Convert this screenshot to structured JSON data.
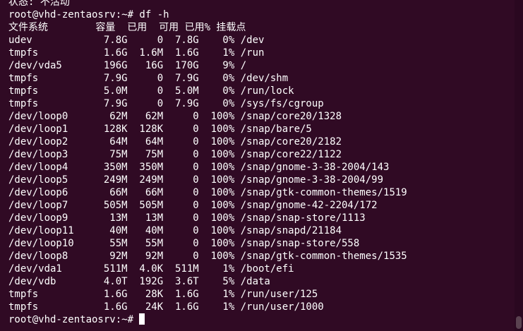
{
  "terminal": {
    "colors": {
      "background": "#300a24",
      "foreground": "#ffffff"
    },
    "lines": [
      "状态: 不活动",
      "root@vhd-zentaosrv:~# df -h",
      "文件系统        容量  已用  可用 已用% 挂载点",
      "udev            7.8G     0  7.8G    0% /dev",
      "tmpfs           1.6G  1.6M  1.6G    1% /run",
      "/dev/vda5       196G   16G  170G    9% /",
      "tmpfs           7.9G     0  7.9G    0% /dev/shm",
      "tmpfs           5.0M     0  5.0M    0% /run/lock",
      "tmpfs           7.9G     0  7.9G    0% /sys/fs/cgroup",
      "/dev/loop0       62M   62M     0  100% /snap/core20/1328",
      "/dev/loop1      128K  128K     0  100% /snap/bare/5",
      "/dev/loop2       64M   64M     0  100% /snap/core20/2182",
      "/dev/loop3       75M   75M     0  100% /snap/core22/1122",
      "/dev/loop4      350M  350M     0  100% /snap/gnome-3-38-2004/143",
      "/dev/loop5      249M  249M     0  100% /snap/gnome-3-38-2004/99",
      "/dev/loop6       66M   66M     0  100% /snap/gtk-common-themes/1519",
      "/dev/loop7      505M  505M     0  100% /snap/gnome-42-2204/172",
      "/dev/loop9       13M   13M     0  100% /snap/snap-store/1113",
      "/dev/loop11      40M   40M     0  100% /snap/snapd/21184",
      "/dev/loop10      55M   55M     0  100% /snap/snap-store/558",
      "/dev/loop8       92M   92M     0  100% /snap/gtk-common-themes/1535",
      "/dev/vda1       511M  4.0K  511M    1% /boot/efi",
      "/dev/vdb        4.0T  192G  3.6T    5% /data",
      "tmpfs           1.6G   28K  1.6G    1% /run/user/125",
      "tmpfs           1.6G   24K  1.6G    1% /run/user/1000"
    ],
    "prompt": "root@vhd-zentaosrv:~# "
  }
}
